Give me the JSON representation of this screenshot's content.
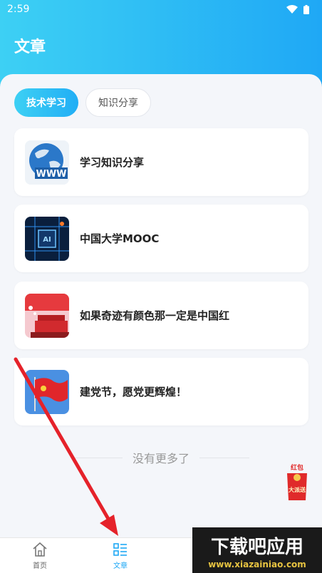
{
  "status_bar": {
    "time": "2:59"
  },
  "page": {
    "title": "文章"
  },
  "tabs": [
    {
      "label": "技术学习",
      "active": true
    },
    {
      "label": "知识分享",
      "active": false
    }
  ],
  "articles": [
    {
      "title": "学习知识分享",
      "thumb": "www-globe-image"
    },
    {
      "title": "中国大学MOOC",
      "thumb": "ai-chip-image"
    },
    {
      "title": "如果奇迹有颜色那一定是中国红",
      "thumb": "tiananmen-image"
    },
    {
      "title": "建党节，愿党更辉煌！",
      "thumb": "party-flag-image"
    }
  ],
  "list_footer": "没有更多了",
  "floating": {
    "hongbao_line1": "红包",
    "hongbao_line2": "大派送"
  },
  "bottom_nav": [
    {
      "label": "首页",
      "icon": "home-icon",
      "active": false
    },
    {
      "label": "文章",
      "icon": "list-icon",
      "active": true
    }
  ],
  "watermark": {
    "title": "下载吧应用",
    "url": "www.xiazainiao.com"
  },
  "colors": {
    "accent": "#1fa8f5",
    "accent_light": "#3dd0f4",
    "arrow": "#e5222a"
  }
}
